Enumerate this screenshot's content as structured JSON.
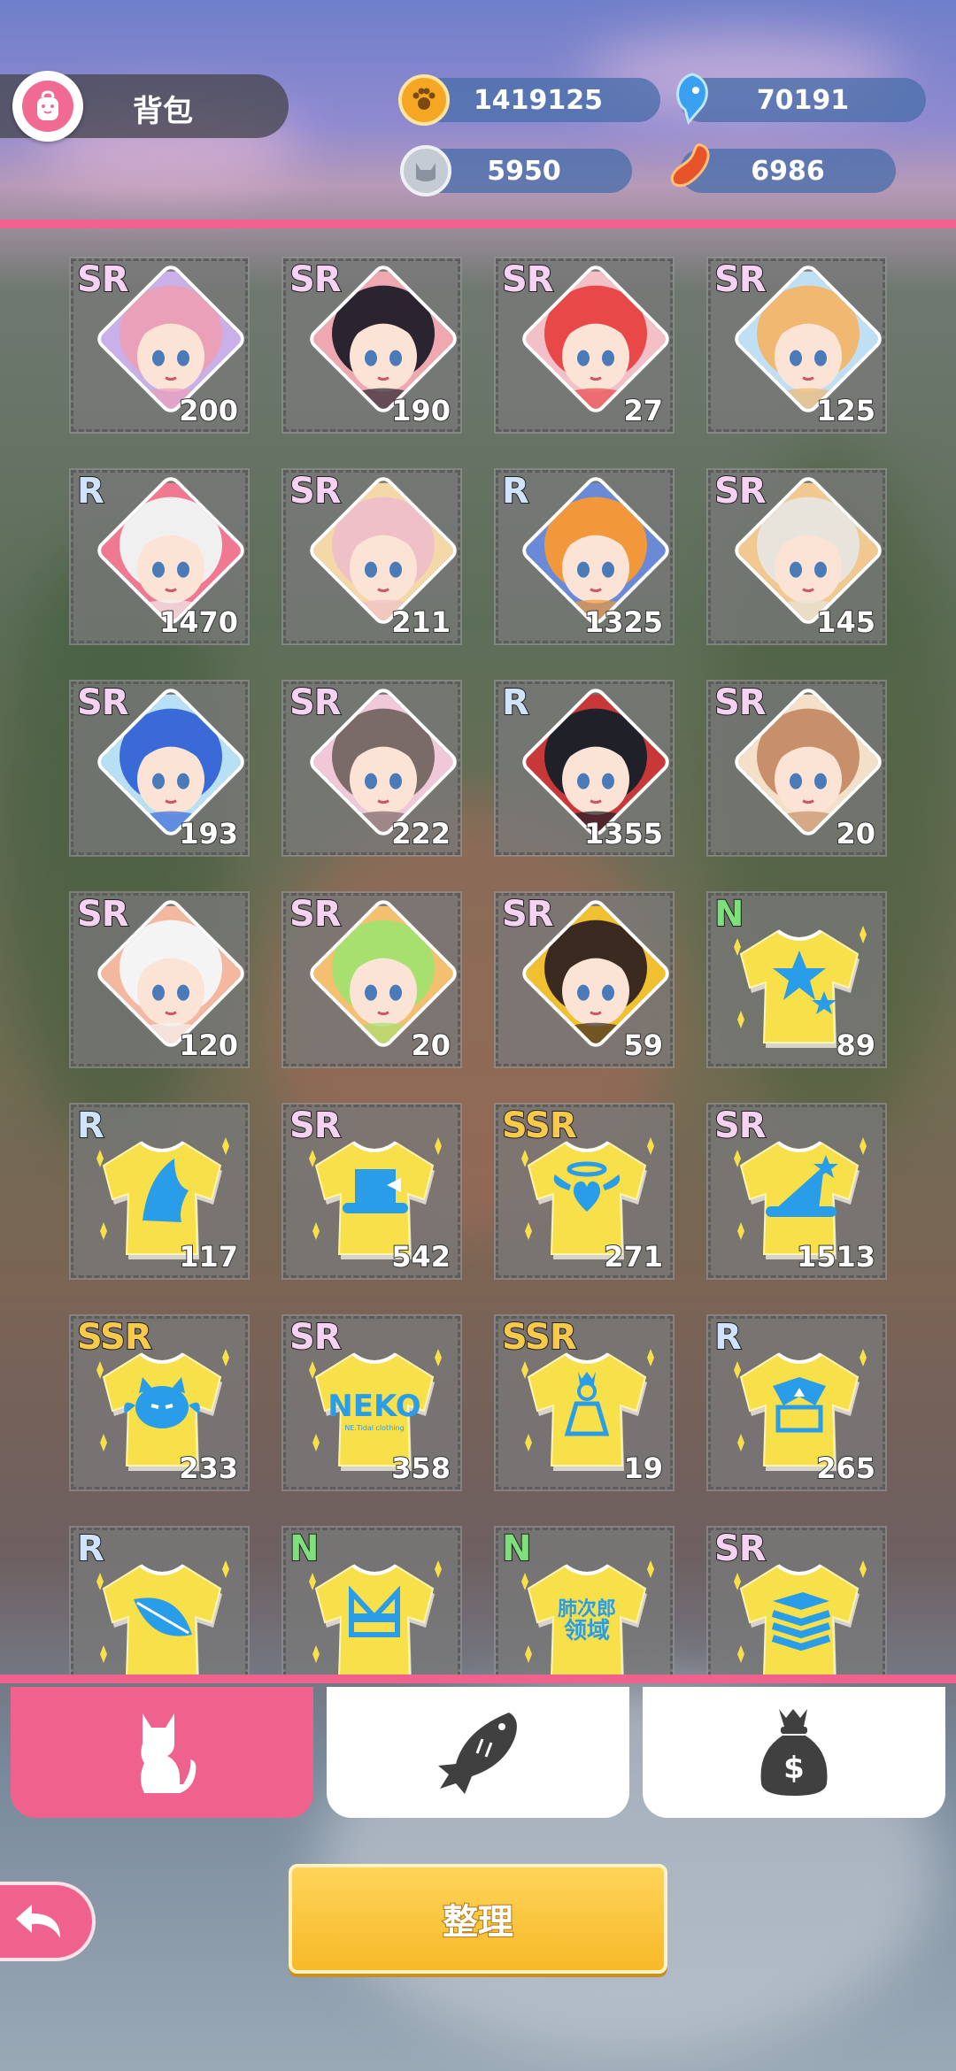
{
  "header": {
    "title": "背包",
    "resources": [
      {
        "name": "paw-coin",
        "value": "1419125",
        "color": "#f0a326"
      },
      {
        "name": "blue-fish",
        "value": "70191",
        "color": "#3aa0f0"
      },
      {
        "name": "silver-cat",
        "value": "5950",
        "color": "#b8bec8"
      },
      {
        "name": "red-bean",
        "value": "6986",
        "color": "#e8542a"
      }
    ]
  },
  "items": [
    {
      "rarity": "SR",
      "count": "200",
      "kind": "character",
      "hair": "#e9a0b8",
      "bg": "#c9b0e8"
    },
    {
      "rarity": "SR",
      "count": "190",
      "kind": "character",
      "hair": "#2a2430",
      "bg": "#f0a8b0"
    },
    {
      "rarity": "SR",
      "count": "27",
      "kind": "character",
      "hair": "#e84848",
      "bg": "#f4c0c8"
    },
    {
      "rarity": "SR",
      "count": "125",
      "kind": "character",
      "hair": "#f0b870",
      "bg": "#bfe0f4"
    },
    {
      "rarity": "R",
      "count": "1470",
      "kind": "character",
      "hair": "#f0f0f0",
      "bg": "#f07890"
    },
    {
      "rarity": "SR",
      "count": "211",
      "kind": "character",
      "hair": "#f0c0c8",
      "bg": "#f4d8a8"
    },
    {
      "rarity": "R",
      "count": "1325",
      "kind": "character",
      "hair": "#f0983a",
      "bg": "#6a8ad8"
    },
    {
      "rarity": "SR",
      "count": "145",
      "kind": "character",
      "hair": "#e8e4dc",
      "bg": "#f0c890"
    },
    {
      "rarity": "SR",
      "count": "193",
      "kind": "character",
      "hair": "#3a6ad8",
      "bg": "#b8e0f4"
    },
    {
      "rarity": "SR",
      "count": "222",
      "kind": "character",
      "hair": "#7a6a68",
      "bg": "#f0c8d8"
    },
    {
      "rarity": "R",
      "count": "1355",
      "kind": "character",
      "hair": "#202028",
      "bg": "#c83838"
    },
    {
      "rarity": "SR",
      "count": "20",
      "kind": "character",
      "hair": "#c8906a",
      "bg": "#f4e0c8"
    },
    {
      "rarity": "SR",
      "count": "120",
      "kind": "character",
      "hair": "#f4f4f4",
      "bg": "#f4b8a0"
    },
    {
      "rarity": "SR",
      "count": "20",
      "kind": "character",
      "hair": "#a8e070",
      "bg": "#f4c070"
    },
    {
      "rarity": "SR",
      "count": "59",
      "kind": "character",
      "hair": "#3a2a20",
      "bg": "#f0c030"
    },
    {
      "rarity": "N",
      "count": "89",
      "kind": "shirt",
      "emblem": "stars"
    },
    {
      "rarity": "R",
      "count": "117",
      "kind": "shirt",
      "emblem": "shark"
    },
    {
      "rarity": "SR",
      "count": "542",
      "kind": "shirt",
      "emblem": "tophat"
    },
    {
      "rarity": "SSR",
      "count": "271",
      "kind": "shirt",
      "emblem": "angel"
    },
    {
      "rarity": "SR",
      "count": "1513",
      "kind": "shirt",
      "emblem": "wizardhat"
    },
    {
      "rarity": "SSR",
      "count": "233",
      "kind": "shirt",
      "emblem": "batcat"
    },
    {
      "rarity": "SR",
      "count": "358",
      "kind": "shirt",
      "emblem": "neko",
      "label": "NEKO",
      "sublabel": "NE.Tidal clothing"
    },
    {
      "rarity": "SSR",
      "count": "19",
      "kind": "shirt",
      "emblem": "princess"
    },
    {
      "rarity": "R",
      "count": "265",
      "kind": "shirt",
      "emblem": "sailor"
    },
    {
      "rarity": "R",
      "count": "",
      "kind": "shirt",
      "emblem": "leaf"
    },
    {
      "rarity": "N",
      "count": "",
      "kind": "shirt",
      "emblem": "kimono"
    },
    {
      "rarity": "N",
      "count": "",
      "kind": "shirt",
      "emblem": "text",
      "label": "肺次郎领域"
    },
    {
      "rarity": "SR",
      "count": "",
      "kind": "shirt",
      "emblem": "books"
    }
  ],
  "tabs": [
    {
      "name": "cat",
      "active": true
    },
    {
      "name": "fish",
      "active": false
    },
    {
      "name": "money-bag",
      "active": false
    }
  ],
  "organize_label": "整理",
  "colors": {
    "accent": "#f0628e",
    "shirt": "#f8e04a",
    "emblem": "#2a9de8",
    "button": "#f7b928"
  }
}
